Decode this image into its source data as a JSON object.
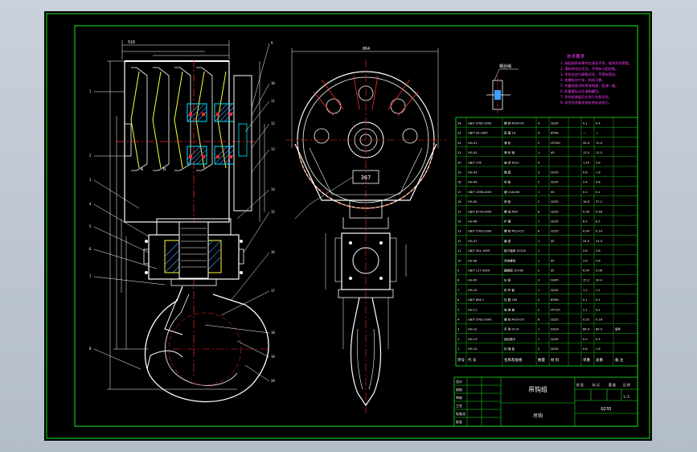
{
  "drawing": {
    "title": "吊钩组",
    "material_code": "Q235",
    "scale": "1:5",
    "sheet_note": "吊钩",
    "dim_top_left": "516",
    "dim_mid_circle": "Φ5",
    "dim_right_top": "864",
    "dim_center_box": "367",
    "detail_label": "钢丝绳"
  },
  "tech_requirements": {
    "heading": "技术要求",
    "lines": [
      "1. 装配前所有零件应清洗干净，轴承涂润滑脂。",
      "2. 滑轮转动应灵活，不得有卡阻现象。",
      "3. 吊钩应进行静载试验，不得有裂纹。",
      "4. 各螺栓应拧紧，防松可靠。",
      "5. 外露表面涂防锈漆两遍，面漆一遍。",
      "6. 起重量标志应清晰醒目。",
      "7. 吊钩组装配后应进行空载试验。",
      "8. 其余技术要求按有关标准执行。"
    ]
  },
  "bom": {
    "header": [
      "序号",
      "代 号",
      "名称及规格",
      "数量",
      "材 料",
      "单重",
      "总重",
      "备 注"
    ],
    "rows": [
      [
        "24",
        "GB/T 5782-2000",
        "螺 栓 M16×30",
        "4",
        "Q235",
        "0.1",
        "0.4",
        ""
      ],
      [
        "23",
        "GB/T 93-1987",
        "垫 圈 16",
        "4",
        "65Mn",
        "—",
        "—",
        ""
      ],
      [
        "22",
        "HG-01",
        "滑 轮",
        "2",
        "HT200",
        "35.0",
        "70.0",
        ""
      ],
      [
        "21",
        "HG-02",
        "滑 轮 轴",
        "1",
        "45",
        "12.5",
        "12.5",
        ""
      ],
      [
        "20",
        "GB/T 276",
        "轴 承 6312",
        "4",
        "",
        "1.45",
        "5.8",
        ""
      ],
      [
        "19",
        "HG-03",
        "隔 套",
        "3",
        "Q235",
        "0.6",
        "1.8",
        ""
      ],
      [
        "18",
        "HG-04",
        "挡 板",
        "2",
        "Q235",
        "2.4",
        "4.8",
        ""
      ],
      [
        "17",
        "GB/T 1096-2003",
        "键 C16×50",
        "1",
        "45",
        "0.1",
        "0.1",
        ""
      ],
      [
        "16",
        "HG-05",
        "侧 板",
        "2",
        "Q235",
        "18.6",
        "37.2",
        ""
      ],
      [
        "15",
        "GB/T 6170-2000",
        "螺 母 M20",
        "8",
        "Q235",
        "0.06",
        "0.48",
        ""
      ],
      [
        "14",
        "HG-06",
        "护 罩",
        "1",
        "Q235",
        "8.5",
        "8.5",
        ""
      ],
      [
        "13",
        "GB/T 5783-2000",
        "螺 栓 M12×25",
        "6",
        "Q235",
        "0.04",
        "0.24",
        ""
      ],
      [
        "12",
        "HG-07",
        "横 梁",
        "1",
        "45",
        "24.0",
        "24.0",
        ""
      ],
      [
        "11",
        "GB/T 301-1995",
        "推力轴承 51220",
        "1",
        "",
        "2.8",
        "2.8",
        ""
      ],
      [
        "10",
        "HG-08",
        "吊钩螺母",
        "1",
        "45",
        "3.6",
        "3.6",
        ""
      ],
      [
        "9",
        "GB/T 117-2000",
        "圆锥销 10×60",
        "2",
        "35",
        "0.04",
        "0.08",
        ""
      ],
      [
        "8",
        "HG-09",
        "拉 板",
        "2",
        "Q345",
        "15.2",
        "30.4",
        ""
      ],
      [
        "7",
        "HG-10",
        "防 护 套",
        "1",
        "Q235",
        "1.2",
        "1.2",
        ""
      ],
      [
        "6",
        "GB/T 894.1",
        "挡 圈 100",
        "2",
        "65Mn",
        "0.1",
        "0.2",
        ""
      ],
      [
        "5",
        "HG-11",
        "轴 端 盖",
        "2",
        "HT150",
        "2.1",
        "4.2",
        ""
      ],
      [
        "4",
        "GB/T 5782-2000",
        "螺 栓 M10×20",
        "8",
        "Q235",
        "0.02",
        "0.16",
        ""
      ],
      [
        "3",
        "HG-12",
        "吊 钩 LY-10",
        "1",
        "DG20",
        "86.0",
        "86.0",
        "锻件"
      ],
      [
        "2",
        "HG-13",
        "钢丝绳卡",
        "1",
        "Q235",
        "0.5",
        "0.5",
        ""
      ],
      [
        "1",
        "HG-14",
        "挡 绳 板",
        "2",
        "Q235",
        "0.8",
        "1.6",
        ""
      ]
    ]
  },
  "title_block": {
    "left_labels": [
      "设计",
      "校核",
      "审核",
      "工艺",
      "标准化",
      "批准"
    ],
    "right_header": [
      "阶 段",
      "标 记",
      "重 量",
      "比 例"
    ]
  },
  "colors": {
    "frame": "#19e619",
    "outline": "#ffffff",
    "center": "#ff2a2a",
    "section": "#00e5ff",
    "hatch": "#3aa0ff",
    "dim": "#ff3cff",
    "table": "#19e619",
    "yellow": "#ffff33"
  }
}
